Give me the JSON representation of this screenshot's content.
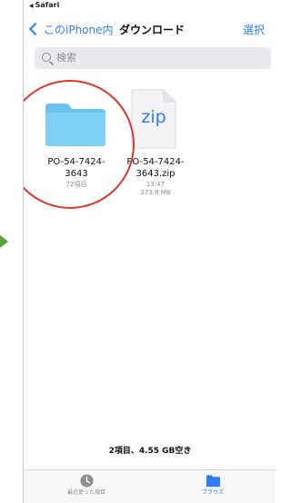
{
  "status_bar": {
    "back_app": "Safari"
  },
  "nav": {
    "back_label": "このiPhone内",
    "title": "ダウンロード",
    "select_label": "選択"
  },
  "search": {
    "placeholder": "検索"
  },
  "files": [
    {
      "name_line1": "PO-54-7424-",
      "name_line2": "3643",
      "meta1": "72項目",
      "icon": "folder-icon"
    },
    {
      "name_line1": "PO-54-7424-",
      "name_line2": "3643.zip",
      "meta1": "13:47",
      "meta2": "373.8 MB",
      "icon": "zip-file-icon",
      "icon_text": "zip"
    }
  ],
  "footer": {
    "summary": "2項目、4.55 GB空き"
  },
  "tabs": [
    {
      "label": "最近使った項目",
      "icon": "clock-icon"
    },
    {
      "label": "ブラウズ",
      "icon": "folder-icon"
    }
  ],
  "colors": {
    "accent": "#2f7cf6",
    "folder": "#6cc2ef",
    "annotation_circle": "#e0382f",
    "annotation_arrow": "#5aa03c"
  }
}
